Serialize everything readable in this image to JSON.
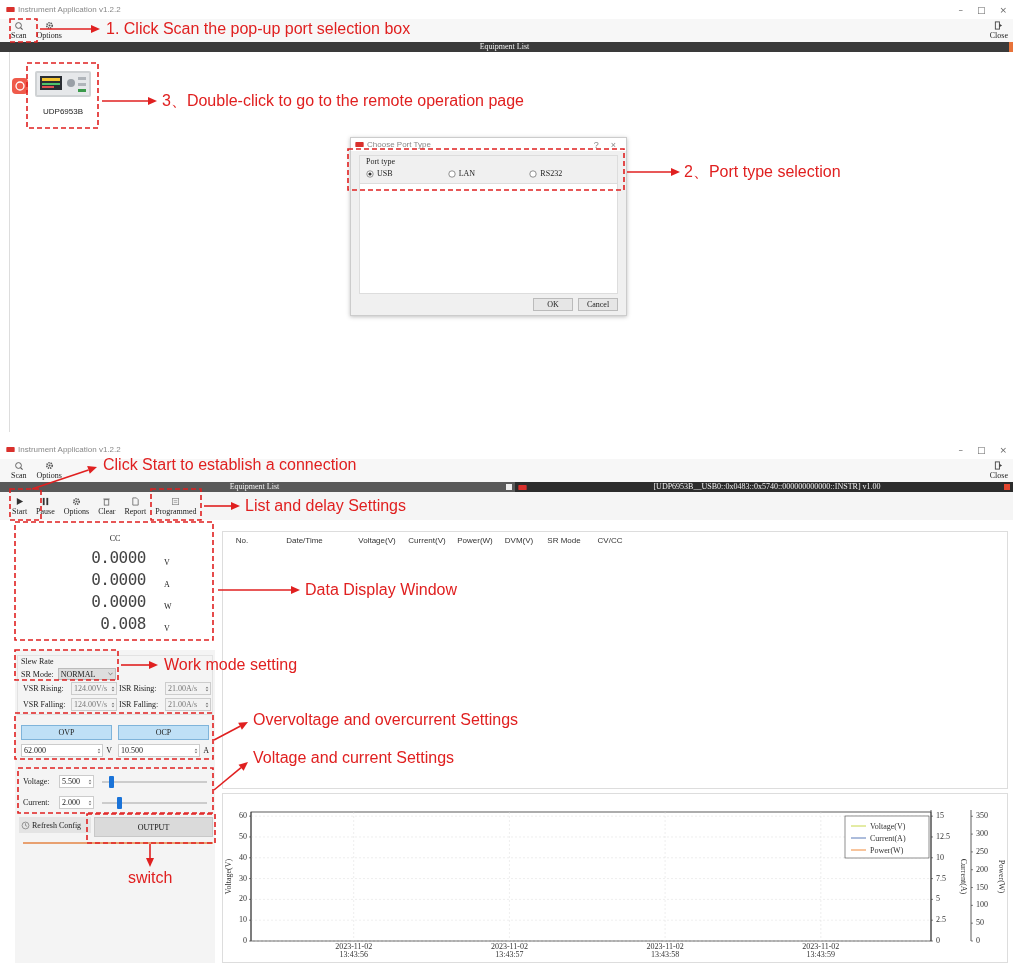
{
  "scan_screen": {
    "window": {
      "title": "Instrument Application v1.2.2",
      "controls": [
        "–",
        "□",
        "×"
      ]
    },
    "toolbar": [
      {
        "label": "Scan"
      },
      {
        "label": "Options"
      }
    ],
    "close_button": "Close",
    "header": "Equipment List",
    "devices": [
      {
        "name": "UDP6953B"
      }
    ],
    "dialog": {
      "title": "Choose Port Type",
      "help": "?",
      "close": "×",
      "group": "Port type",
      "options": [
        {
          "label": "USB",
          "selected": true
        },
        {
          "label": "LAN",
          "selected": false
        },
        {
          "label": "RS232",
          "selected": false
        }
      ],
      "buttons": [
        "OK",
        "Cancel"
      ]
    }
  },
  "control_screen": {
    "window": {
      "title": "Instrument Application v1.2.2",
      "controls": [
        "–",
        "□",
        "×"
      ]
    },
    "toolbar": [
      {
        "label": "Scan"
      },
      {
        "label": "Options"
      }
    ],
    "close_button": "Close",
    "tabs": [
      {
        "label": "Equipment List",
        "selected": false
      },
      {
        "label": "[UDP6953B__USB0::0x0483::0x5740::000000000000::INSTR] v1.00",
        "selected": true
      }
    ],
    "actions": [
      {
        "label": "Start"
      },
      {
        "label": "Pause"
      },
      {
        "label": "Options"
      },
      {
        "label": "Clear"
      },
      {
        "label": "Report"
      },
      {
        "label": "Programmed"
      }
    ],
    "readout": {
      "mode": "CC",
      "values": [
        {
          "value": "0.0000",
          "unit": "V"
        },
        {
          "value": "0.0000",
          "unit": "A"
        },
        {
          "value": "0.0000",
          "unit": "W"
        },
        {
          "value": "0.008",
          "unit": "V"
        }
      ]
    },
    "slew_rate": {
      "title": "Slew Rate",
      "mode_label": "SR Mode:",
      "mode": "NORMAL",
      "fields": [
        {
          "label": "VSR Rising:",
          "value": "124.00V/s",
          "disabled": true
        },
        {
          "label": "ISR Rising:",
          "value": "21.00A/s",
          "disabled": true
        },
        {
          "label": "VSR Falling:",
          "value": "124.00V/s",
          "disabled": true
        },
        {
          "label": "ISR Falling:",
          "value": "21.00A/s",
          "disabled": true
        }
      ]
    },
    "protection": [
      {
        "button": "OVP",
        "value": "62.000",
        "unit": "V"
      },
      {
        "button": "OCP",
        "value": "10.500",
        "unit": "A"
      }
    ],
    "setpoints": [
      {
        "label": "Voltage:",
        "value": "5.500",
        "level": 0.07
      },
      {
        "label": "Current:",
        "value": "2.000",
        "level": 0.14
      }
    ],
    "refresh_button": "Refresh Config",
    "output_button": "OUTPUT",
    "table": {
      "columns": [
        "No.",
        "Date/Time",
        "Voltage(V)",
        "Current(V)",
        "Power(W)",
        "DVM(V)",
        "SR Mode",
        "CV/CC"
      ]
    },
    "chart": {
      "chart_data": {
        "type": "line",
        "grid": true,
        "ylabel": "Voltage(V)",
        "categories": [
          "2023-11-02 13:43:56",
          "2023-11-02 13:43:57",
          "2023-11-02 13:43:58",
          "2023-11-02 13:43:59"
        ],
        "ylim": [
          0,
          62
        ],
        "yticks": [
          0,
          10,
          20,
          30,
          40,
          50,
          60
        ],
        "y2label": "Current(A)",
        "y2lim": [
          0,
          15.5
        ],
        "y2ticks": [
          0,
          2.5,
          5,
          7.5,
          10,
          12.5,
          15
        ],
        "y3label": "Power(W)",
        "y3lim": [
          0,
          362
        ],
        "y3ticks": [
          0,
          50,
          100,
          150,
          200,
          250,
          300,
          350
        ],
        "series": [
          {
            "name": "Voltage(V)",
            "color": "#c8d84a",
            "values": [
              null,
              null,
              null,
              null
            ]
          },
          {
            "name": "Current(A)",
            "color": "#5a7ab8",
            "values": [
              null,
              null,
              null,
              null
            ]
          },
          {
            "name": "Power(W)",
            "color": "#f08a3a",
            "values": [
              null,
              null,
              null,
              null
            ]
          }
        ]
      }
    }
  },
  "annotations": [
    {
      "text": "1. Click Scan the pop-up port selection box"
    },
    {
      "text": "3、Double-click to go to the remote operation page"
    },
    {
      "text": "2、Port type selection"
    },
    {
      "text": "Click Start to establish a connection"
    },
    {
      "text": "List and delay Settings"
    },
    {
      "text": "Data Display Window"
    },
    {
      "text": "Work mode setting"
    },
    {
      "text": "Overvoltage and overcurrent Settings"
    },
    {
      "text": "Voltage and current Settings"
    },
    {
      "text": "switch"
    }
  ]
}
